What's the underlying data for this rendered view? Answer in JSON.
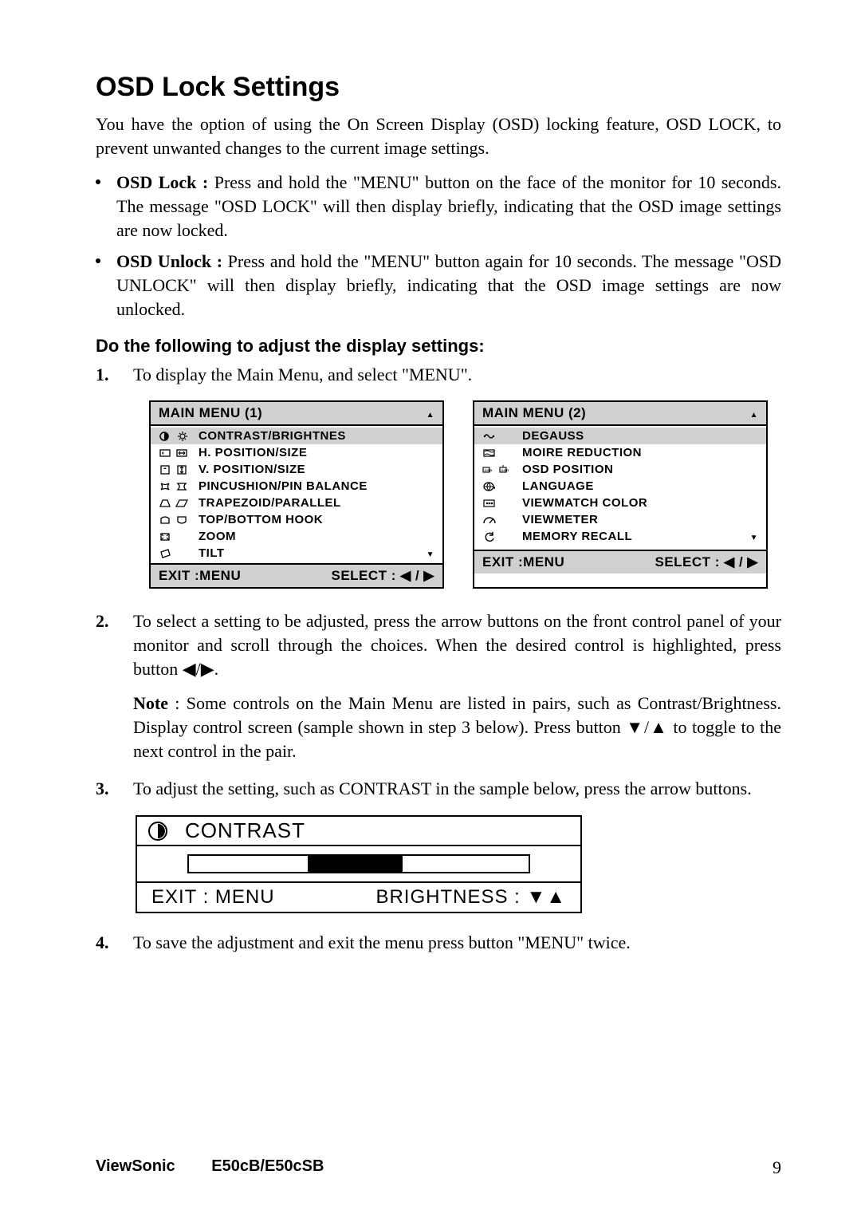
{
  "title": "OSD Lock Settings",
  "intro": "You have the option of using the On Screen Display (OSD) locking feature, OSD LOCK, to prevent unwanted changes to the current image settings.",
  "bullets": [
    {
      "lead": "OSD Lock : ",
      "text": "Press and hold the \"MENU\" button on the face of the monitor for 10 seconds. The message \"OSD LOCK\" will then display briefly, indicating that the OSD image settings are now locked."
    },
    {
      "lead": "OSD Unlock : ",
      "text": "Press and hold the \"MENU\" button again for 10 seconds. The message \"OSD UNLOCK\" will then display briefly, indicating that the OSD image settings are now unlocked."
    }
  ],
  "do_following": "Do the following to adjust the display settings:",
  "steps": {
    "s1": {
      "num": "1.",
      "text": "To display the Main Menu, and select \"MENU\"."
    },
    "s2": {
      "num": "2.",
      "text": "To select a setting to be adjusted, press the arrow buttons on the front control panel of your monitor and scroll through the choices. When the desired control is highlighted, press button ◀/▶.",
      "note_lead": "Note",
      "note_text": " : Some controls on the Main Menu are listed in pairs, such as Contrast/Brightness. Display control screen (sample shown in step 3 below). Press button ▼/▲ to toggle to the next control in the pair."
    },
    "s3": {
      "num": "3.",
      "text": "To adjust the setting, such as CONTRAST in the sample below, press the arrow buttons."
    },
    "s4": {
      "num": "4.",
      "text": "To save the adjustment and exit the menu press button \"MENU\" twice."
    }
  },
  "menu1": {
    "title": "MAIN MENU (1)",
    "items": [
      "CONTRAST/BRIGHTNES",
      "H. POSITION/SIZE",
      "V. POSITION/SIZE",
      "PINCUSHION/PIN BALANCE",
      "TRAPEZOID/PARALLEL",
      "TOP/BOTTOM HOOK",
      "ZOOM",
      "TILT"
    ],
    "exit": "EXIT :MENU",
    "select": "SELECT : ◀ / ▶"
  },
  "menu2": {
    "title": "MAIN MENU (2)",
    "items": [
      "DEGAUSS",
      "MOIRE REDUCTION",
      "OSD POSITION",
      "LANGUAGE",
      "VIEWMATCH COLOR",
      "VIEWMETER",
      "MEMORY RECALL"
    ],
    "exit": "EXIT :MENU",
    "select": "SELECT : ◀ / ▶"
  },
  "contrast": {
    "title": "CONTRAST",
    "exit": "EXIT : MENU",
    "right": "BRIGHTNESS : ▼▲"
  },
  "footer": {
    "brand": "ViewSonic",
    "model": "E50cB/E50cSB",
    "page": "9"
  }
}
